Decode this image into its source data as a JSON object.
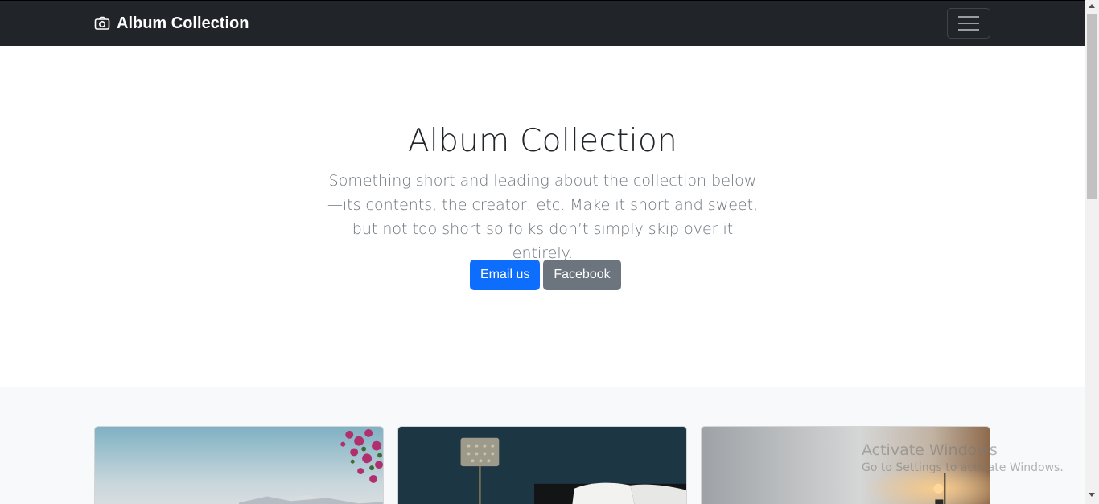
{
  "navbar": {
    "brand": "Album Collection",
    "brand_icon": "camera-icon",
    "toggler_icon": "hamburger-menu-icon",
    "background": "#212529"
  },
  "hero": {
    "title": "Album Collection",
    "lead": "Something short and leading about the collection below—its contents, the creator, etc. Make it short and sweet, but not too short so folks don’t simply skip over it entirely.",
    "primary_button": "Email us",
    "secondary_button": "Facebook"
  },
  "album": {
    "cards": [
      {
        "image": "seaside-flowers-photo"
      },
      {
        "image": "bedroom-lamp-photo"
      },
      {
        "image": "wall-lamp-photo"
      }
    ]
  },
  "watermark": {
    "title": "Activate Windows",
    "subtitle": "Go to Settings to activate Windows."
  },
  "colors": {
    "primary": "#0d6efd",
    "secondary": "#6c757d",
    "album_bg": "#f8f9fa"
  }
}
